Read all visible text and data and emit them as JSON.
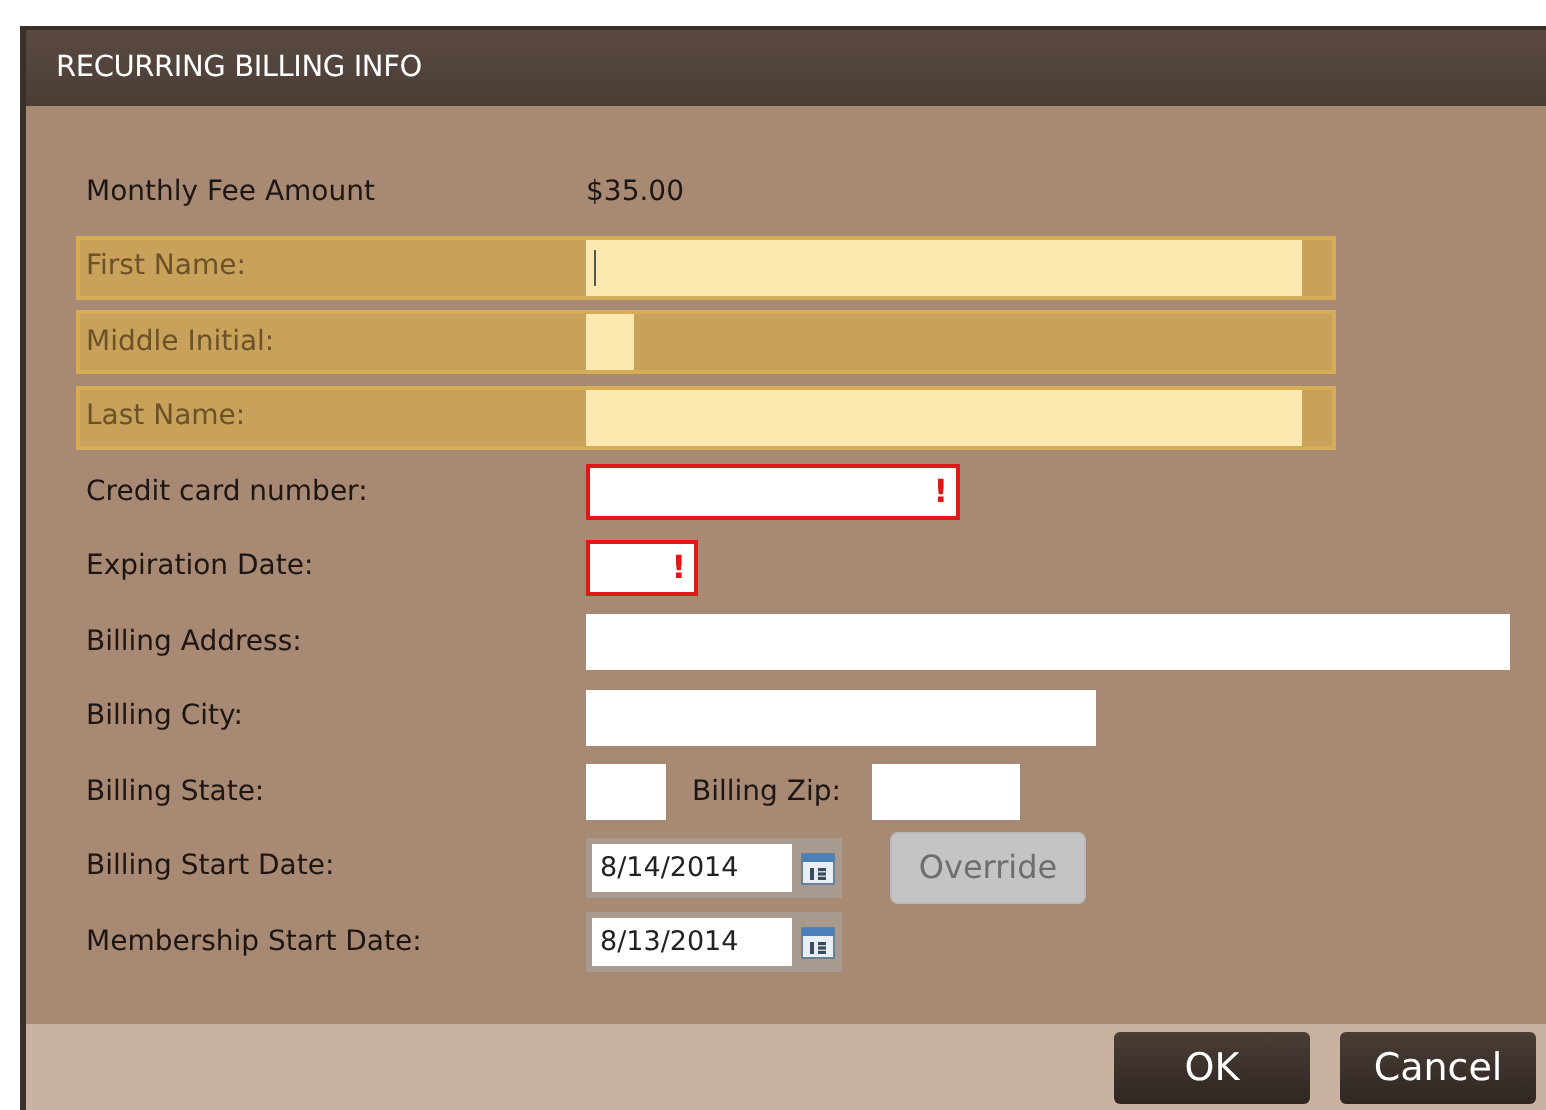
{
  "window": {
    "title": "RECURRING BILLING INFO"
  },
  "rows": [
    {
      "kind": "static",
      "label": "Monthly Fee Amount",
      "value": "$35.00"
    },
    {
      "kind": "field",
      "label": "First Name:",
      "highlighted": true,
      "focused": true
    },
    {
      "kind": "field",
      "label": "Middle Initial:",
      "highlighted": true
    },
    {
      "kind": "field",
      "label": "Last Name:",
      "highlighted": true
    },
    {
      "kind": "field",
      "label": "Credit card number:",
      "error": true,
      "error_mark": "!"
    },
    {
      "kind": "field",
      "label": "Expiration Date:",
      "error": true,
      "error_mark": "!"
    },
    {
      "kind": "field",
      "label": "Billing Address:"
    },
    {
      "kind": "field",
      "label": "Billing City:"
    },
    {
      "kind": "pair",
      "label": "Billing State:",
      "second_label": "Billing Zip:"
    },
    {
      "kind": "date",
      "label": "Billing Start Date:",
      "value": "8/14/2014",
      "button": {
        "label": "Override",
        "disabled": true
      }
    },
    {
      "kind": "date",
      "label": "Membership Start Date:",
      "value": "8/13/2014"
    }
  ],
  "buttons": [
    {
      "label": "OK"
    },
    {
      "label": "Cancel"
    }
  ]
}
